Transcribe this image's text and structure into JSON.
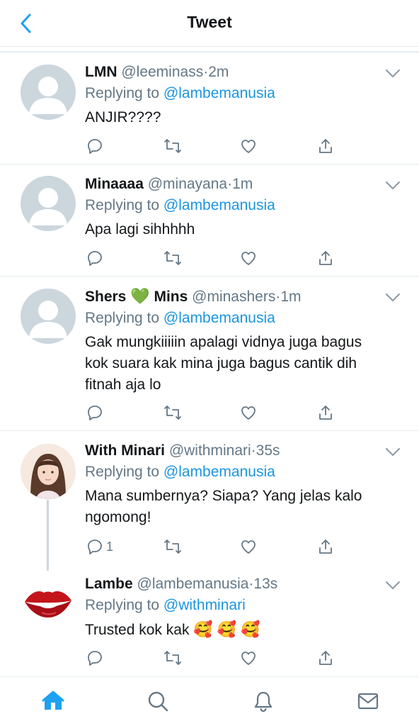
{
  "header": {
    "title": "Tweet",
    "back_icon": "chevron-left-icon"
  },
  "colors": {
    "accent": "#1da1f2",
    "link": "#1b95e0",
    "secondary_text": "#657786",
    "border": "#e6ecf0",
    "heart_emoji": "#5fd35f"
  },
  "tweets": [
    {
      "name": "LMN",
      "handle": "@leeminass",
      "time": "2m",
      "replying_prefix": "Replying to ",
      "replying_to": "@lambemanusia",
      "text_lines": [
        "ANJIR????"
      ],
      "reply_count": "",
      "avatar": "default-avatar"
    },
    {
      "name": "Minaaaa",
      "handle": "@minayana",
      "time": "1m",
      "replying_prefix": "Replying to ",
      "replying_to": "@lambemanusia",
      "text_lines": [
        "Apa lagi sihhhhh"
      ],
      "reply_count": "",
      "avatar": "default-avatar"
    },
    {
      "name_part1": "Shers",
      "name_emoji": "💚",
      "name_part2": "Mins",
      "handle": "@minashers",
      "time": "1m",
      "replying_prefix": "Replying to ",
      "replying_to": "@lambemanusia",
      "text_lines": [
        "Gak mungkiiiiin apalagi vidnya juga bagus",
        "kok suara kak mina juga bagus cantik dih",
        "fitnah aja lo"
      ],
      "reply_count": "",
      "avatar": "default-avatar"
    },
    {
      "name": "With Minari",
      "handle": "@withminari",
      "time": "35s",
      "replying_prefix": "Replying to ",
      "replying_to": "@lambemanusia",
      "text_lines": [
        "Mana sumbernya? Siapa? Yang jelas kalo",
        "ngomong!"
      ],
      "reply_count": "1",
      "avatar": "girl-photo-avatar"
    },
    {
      "name": "Lambe",
      "handle": "@lambemanusia",
      "time": "13s",
      "replying_prefix": "Replying to ",
      "replying_to": "@withminari",
      "text": "Trusted kok kak",
      "emojis": "🥰 🥰 🥰",
      "reply_count": "",
      "avatar": "lips-avatar"
    }
  ],
  "dot": "·",
  "tabbar": {
    "items": [
      "home-icon",
      "search-icon",
      "notifications-icon",
      "messages-icon"
    ],
    "active": "home-icon"
  }
}
